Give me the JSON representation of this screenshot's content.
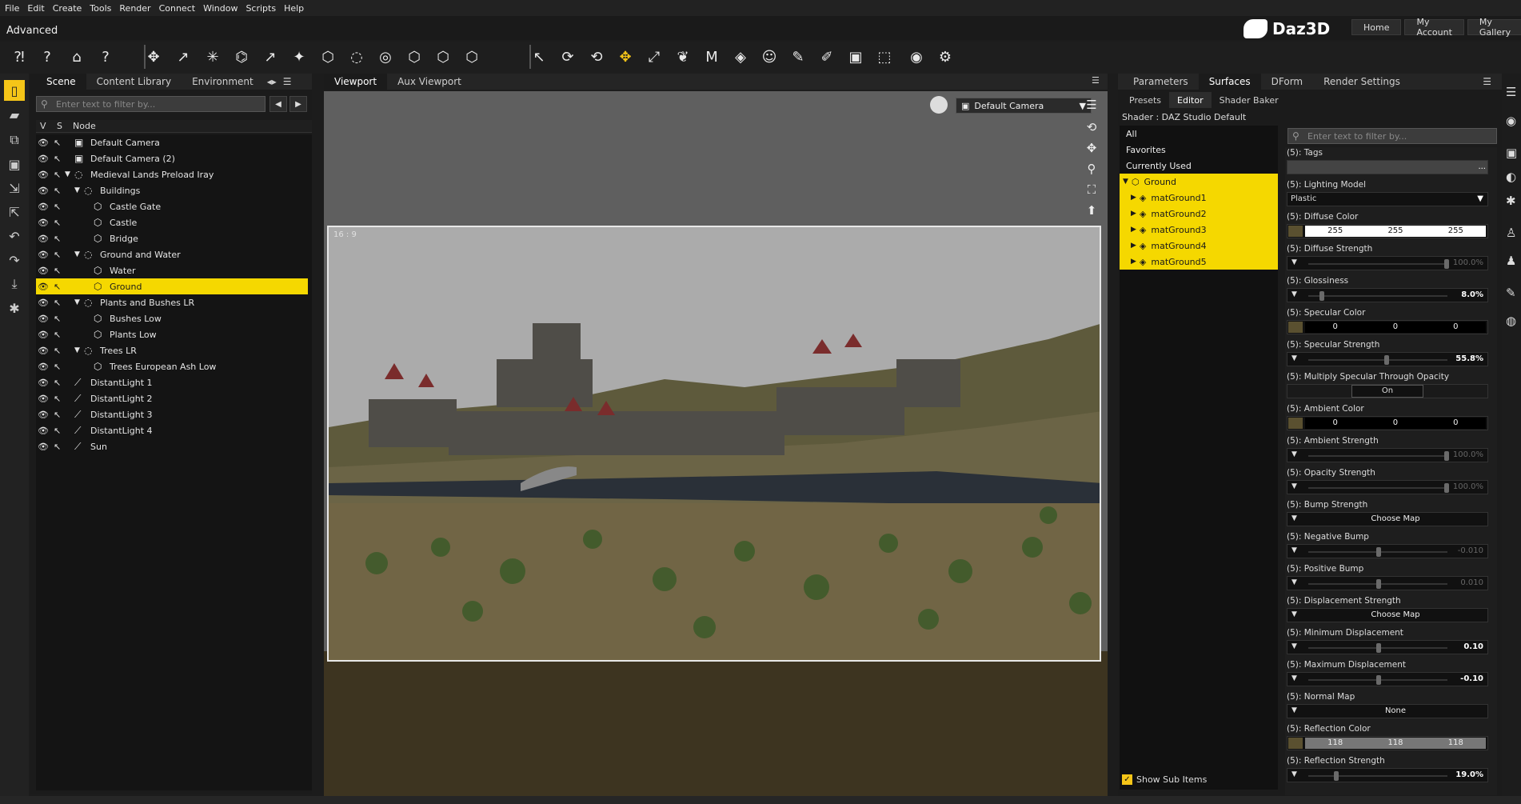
{
  "menu": [
    "File",
    "Edit",
    "Create",
    "Tools",
    "Render",
    "Connect",
    "Window",
    "Scripts",
    "Help"
  ],
  "layout_name": "Advanced",
  "brand": "Daz3D",
  "top_nav": [
    "Home",
    "My Account",
    "My Gallery"
  ],
  "scene_tabs": [
    "Scene",
    "Content Library",
    "Environment"
  ],
  "filter_placeholder": "Enter text to filter by...",
  "scene_columns": {
    "v": "V",
    "s": "S",
    "node": "Node"
  },
  "scene_nodes": [
    {
      "label": "Default Camera",
      "icon": "camera-icon",
      "level": 0,
      "twisty": ""
    },
    {
      "label": "Default Camera (2)",
      "icon": "camera-icon",
      "level": 0,
      "twisty": ""
    },
    {
      "label": "Medieval Lands Preload Iray",
      "icon": "group-icon",
      "level": 0,
      "twisty": "▼"
    },
    {
      "label": "Buildings",
      "icon": "group-icon",
      "level": 1,
      "twisty": "▼"
    },
    {
      "label": "Castle Gate",
      "icon": "figure-icon",
      "level": 2,
      "twisty": ""
    },
    {
      "label": "Castle",
      "icon": "figure-icon",
      "level": 2,
      "twisty": ""
    },
    {
      "label": "Bridge",
      "icon": "figure-icon",
      "level": 2,
      "twisty": ""
    },
    {
      "label": "Ground and Water",
      "icon": "group-icon",
      "level": 1,
      "twisty": "▼"
    },
    {
      "label": "Water",
      "icon": "figure-icon",
      "level": 2,
      "twisty": ""
    },
    {
      "label": "Ground",
      "icon": "figure-icon",
      "level": 2,
      "twisty": "",
      "selected": true
    },
    {
      "label": "Plants and Bushes LR",
      "icon": "group-icon",
      "level": 1,
      "twisty": "▼"
    },
    {
      "label": "Bushes Low",
      "icon": "figure-icon",
      "level": 2,
      "twisty": ""
    },
    {
      "label": "Plants Low",
      "icon": "figure-icon",
      "level": 2,
      "twisty": ""
    },
    {
      "label": "Trees LR",
      "icon": "group-icon",
      "level": 1,
      "twisty": "▼"
    },
    {
      "label": "Trees European Ash Low",
      "icon": "figure-icon",
      "level": 2,
      "twisty": ""
    },
    {
      "label": "DistantLight 1",
      "icon": "light-icon",
      "level": 0,
      "twisty": ""
    },
    {
      "label": "DistantLight 2",
      "icon": "light-icon",
      "level": 0,
      "twisty": ""
    },
    {
      "label": "DistantLight 3",
      "icon": "light-icon",
      "level": 0,
      "twisty": ""
    },
    {
      "label": "DistantLight 4",
      "icon": "light-icon",
      "level": 0,
      "twisty": ""
    },
    {
      "label": "Sun",
      "icon": "light-icon",
      "level": 0,
      "twisty": ""
    }
  ],
  "viewport_tabs": [
    "Viewport",
    "Aux Viewport"
  ],
  "viewport": {
    "aspect": "16 : 9",
    "camera": "Default Camera"
  },
  "right_tabs": [
    "Parameters",
    "Surfaces",
    "DForm",
    "Render Settings"
  ],
  "surfaces_subtabs": [
    "Presets",
    "Editor",
    "Shader Baker"
  ],
  "shader_label": "Shader : DAZ Studio Default",
  "material_groups": [
    "All",
    "Favorites",
    "Currently Used"
  ],
  "material_root": "Ground",
  "materials": [
    "matGround1",
    "matGround2",
    "matGround3",
    "matGround4",
    "matGround5"
  ],
  "show_sub_items": "Show Sub Items",
  "properties": [
    {
      "label": "(5): Tags",
      "kind": "tags",
      "value": "..."
    },
    {
      "label": "(5): Lighting Model",
      "kind": "dropdown",
      "value": "Plastic"
    },
    {
      "label": "(5): Diffuse Color",
      "kind": "color",
      "values": [
        "255",
        "255",
        "255"
      ],
      "light": true
    },
    {
      "label": "(5): Diffuse Strength",
      "kind": "slider",
      "value": "100.0%",
      "fraction": 1.0,
      "dim": true
    },
    {
      "label": "(5): Glossiness",
      "kind": "slider",
      "value": "8.0%",
      "fraction": 0.08
    },
    {
      "label": "(5): Specular Color",
      "kind": "color",
      "values": [
        "0",
        "0",
        "0"
      ],
      "light": false
    },
    {
      "label": "(5): Specular Strength",
      "kind": "slider",
      "value": "55.8%",
      "fraction": 0.558
    },
    {
      "label": "(5): Multiply Specular Through Opacity",
      "kind": "toggle",
      "value": "On"
    },
    {
      "label": "(5): Ambient Color",
      "kind": "color",
      "values": [
        "0",
        "0",
        "0"
      ],
      "light": false
    },
    {
      "label": "(5): Ambient Strength",
      "kind": "slider",
      "value": "100.0%",
      "fraction": 1.0,
      "dim": true
    },
    {
      "label": "(5): Opacity Strength",
      "kind": "slider",
      "value": "100.0%",
      "fraction": 1.0,
      "dim": true
    },
    {
      "label": "(5): Bump Strength",
      "kind": "map",
      "value": "Choose Map"
    },
    {
      "label": "(5): Negative Bump",
      "kind": "slider",
      "value": "-0.010",
      "fraction": 0.5,
      "dim": true
    },
    {
      "label": "(5): Positive Bump",
      "kind": "slider",
      "value": "0.010",
      "fraction": 0.5,
      "dim": true
    },
    {
      "label": "(5): Displacement Strength",
      "kind": "map",
      "value": "Choose Map"
    },
    {
      "label": "(5): Minimum Displacement",
      "kind": "slider",
      "value": "0.10",
      "fraction": 0.5
    },
    {
      "label": "(5): Maximum Displacement",
      "kind": "slider",
      "value": "-0.10",
      "fraction": 0.5
    },
    {
      "label": "(5): Normal Map",
      "kind": "map",
      "value": "None"
    },
    {
      "label": "(5): Reflection Color",
      "kind": "color",
      "values": [
        "118",
        "118",
        "118"
      ],
      "light": true,
      "grey": true
    },
    {
      "label": "(5): Reflection Strength",
      "kind": "slider",
      "value": "19.0%",
      "fraction": 0.19
    }
  ],
  "colors": {
    "accent": "#f5c518",
    "selection": "#f5d800"
  }
}
